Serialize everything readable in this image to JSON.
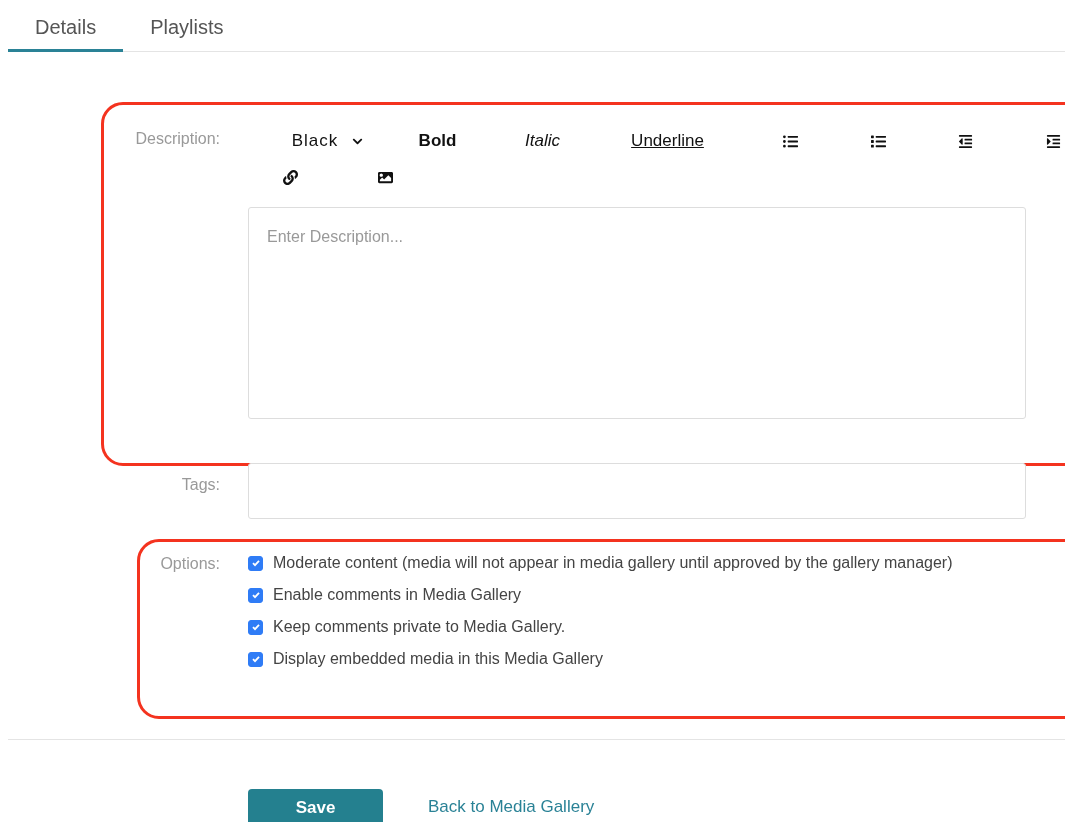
{
  "tabs": [
    {
      "label": "Details",
      "selected": true
    },
    {
      "label": "Playlists",
      "selected": false
    }
  ],
  "description": {
    "label": "Description:",
    "toolbar": [
      {
        "kind": "dropdown",
        "label": "Black"
      },
      {
        "kind": "bold",
        "label": "Bold"
      },
      {
        "kind": "italic",
        "label": "Italic"
      },
      {
        "kind": "underline",
        "label": "Underline"
      }
    ],
    "placeholder": "Enter Description..."
  },
  "tags": {
    "label": "Tags:"
  },
  "options": {
    "label": "Options:",
    "items": [
      {
        "label": "Moderate content (media will not appear in media gallery until approved by the gallery manager)",
        "checked": true
      },
      {
        "label": "Enable comments in Media Gallery",
        "checked": true
      },
      {
        "label": "Keep comments private to Media Gallery.",
        "checked": true
      },
      {
        "label": "Display embedded media in this Media Gallery",
        "checked": true
      }
    ]
  },
  "actions": {
    "save": "Save",
    "back": "Back to Media Gallery"
  }
}
